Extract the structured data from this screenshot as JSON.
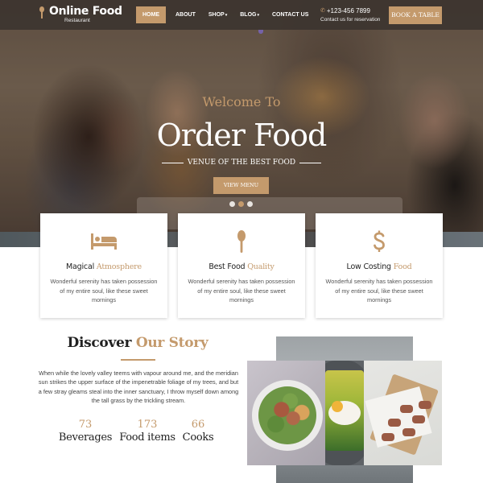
{
  "brand": {
    "name": "Online Food",
    "tagline": "Restaurant",
    "accent_color": "#c49a6c"
  },
  "nav": {
    "items": [
      {
        "label": "HOME",
        "active": true
      },
      {
        "label": "ABOUT",
        "active": false
      },
      {
        "label": "SHOP",
        "active": false,
        "dropdown": true
      },
      {
        "label": "BLOG",
        "active": false,
        "dropdown": true
      },
      {
        "label": "CONTACT US",
        "active": false
      }
    ],
    "caret": "▾",
    "phone": "+123-456 7899",
    "phone_icon": "phone-icon",
    "phone_sub": "Contact us for reservation",
    "cta_label": "BOOK A TABLE"
  },
  "hero": {
    "welcome": "Welcome To",
    "title": "Order Food",
    "tagline": "VENUE OF THE BEST FOOD",
    "button_label": "VIEW MENU",
    "slides": 3,
    "active_slide": 2
  },
  "features": [
    {
      "icon": "bed-icon",
      "title_main": "Magical",
      "title_accent": "Atmosphere",
      "desc": "Wonderful serenity has taken possession of my entire soul, like these sweet mornings"
    },
    {
      "icon": "spoon-icon",
      "title_main": "Best Food",
      "title_accent": "Quality",
      "desc": "Wonderful serenity has taken possession of my entire soul, like these sweet mornings"
    },
    {
      "icon": "dollar-icon",
      "title_main": "Low Costing",
      "title_accent": "Food",
      "desc": "Wonderful serenity has taken possession of my entire soul, like these sweet mornings"
    }
  ],
  "story": {
    "title_main": "Discover",
    "title_accent": "Our Story",
    "text": "When while the lovely valley teems with vapour around me, and the meridian sun strikes the upper surface of the impenetrable foliage of my trees, and but a few stray gleams steal into the inner sanctuary, I throw myself down among the tall grass by the trickling stream.",
    "stats": [
      {
        "value": "73",
        "label": "Beverages"
      },
      {
        "value": "173",
        "label": "Food items"
      },
      {
        "value": "66",
        "label": "Cooks"
      }
    ]
  },
  "gallery": [
    {
      "alt": "salad-plate"
    },
    {
      "alt": "poached-egg-toast"
    },
    {
      "alt": "bacon-wrapped-bites"
    }
  ]
}
